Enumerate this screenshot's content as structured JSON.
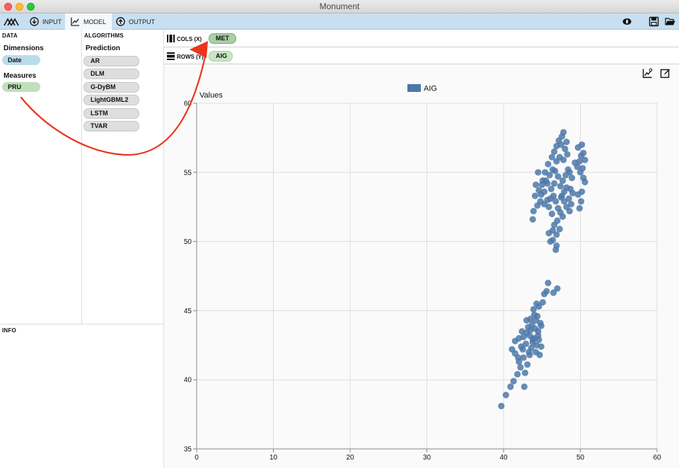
{
  "window": {
    "title": "Monument"
  },
  "tabs": [
    {
      "label": "INPUT",
      "icon": "download-circle-icon"
    },
    {
      "label": "MODEL",
      "icon": "chart-icon"
    },
    {
      "label": "OUTPUT",
      "icon": "upload-circle-icon"
    }
  ],
  "data_panel": {
    "header": "DATA",
    "dimensions_title": "Dimensions",
    "dimensions": [
      "Date"
    ],
    "measures_title": "Measures",
    "measures": [
      "PRU"
    ]
  },
  "algorithms_panel": {
    "header": "ALGORITHMS",
    "section": "Prediction",
    "items": [
      "AR",
      "DLM",
      "G-DyBM",
      "LightGBML2",
      "LSTM",
      "TVAR"
    ]
  },
  "info_panel": {
    "header": "INFO"
  },
  "shelves": {
    "cols_label": "COLS (X)",
    "cols_pill": "MET",
    "rows_label": "ROWS (Y)",
    "rows_pill": "AIG"
  },
  "colors": {
    "accent": "#4c78a8",
    "toolbar": "#c7dff0",
    "annotation": "#e8361d"
  },
  "chart_data": {
    "type": "scatter",
    "legend": [
      "AIG"
    ],
    "legend_position": "top-center",
    "ylabel": "Values",
    "xlim": [
      0,
      60
    ],
    "ylim": [
      35,
      60
    ],
    "xticks": [
      0,
      10,
      20,
      30,
      40,
      50,
      60
    ],
    "yticks": [
      35,
      40,
      45,
      50,
      55,
      60
    ],
    "grid": true,
    "series": [
      {
        "name": "AIG",
        "points": [
          [
            39.7,
            38.1
          ],
          [
            40.3,
            38.9
          ],
          [
            40.9,
            39.5
          ],
          [
            41.3,
            39.9
          ],
          [
            42.7,
            39.5
          ],
          [
            41.8,
            40.4
          ],
          [
            42.2,
            40.9
          ],
          [
            42.0,
            41.3
          ],
          [
            42.6,
            41.6
          ],
          [
            43.1,
            41.1
          ],
          [
            43.4,
            41.8
          ],
          [
            41.1,
            42.2
          ],
          [
            41.5,
            41.9
          ],
          [
            42.3,
            42.4
          ],
          [
            42.9,
            42.6
          ],
          [
            43.6,
            42.3
          ],
          [
            44.2,
            42.0
          ],
          [
            41.5,
            42.8
          ],
          [
            42.0,
            43.0
          ],
          [
            42.6,
            43.1
          ],
          [
            43.0,
            43.4
          ],
          [
            43.4,
            43.2
          ],
          [
            43.8,
            42.9
          ],
          [
            44.3,
            42.5
          ],
          [
            44.6,
            42.9
          ],
          [
            42.4,
            43.5
          ],
          [
            43.2,
            43.8
          ],
          [
            43.7,
            44.0
          ],
          [
            44.1,
            43.7
          ],
          [
            44.5,
            43.5
          ],
          [
            44.9,
            43.9
          ],
          [
            43.5,
            44.4
          ],
          [
            44.0,
            44.7
          ],
          [
            44.4,
            44.6
          ],
          [
            43.9,
            45.1
          ],
          [
            44.6,
            45.3
          ],
          [
            45.1,
            45.6
          ],
          [
            44.3,
            45.5
          ],
          [
            45.3,
            46.2
          ],
          [
            45.6,
            46.4
          ],
          [
            45.8,
            47.0
          ],
          [
            46.5,
            46.3
          ],
          [
            47.0,
            46.6
          ],
          [
            43.8,
            42.7
          ],
          [
            44.0,
            43.0
          ],
          [
            44.5,
            43.2
          ],
          [
            43.3,
            42.0
          ],
          [
            42.5,
            42.2
          ],
          [
            41.9,
            41.6
          ],
          [
            42.8,
            40.5
          ],
          [
            44.7,
            41.8
          ],
          [
            44.9,
            42.4
          ],
          [
            43.0,
            44.3
          ],
          [
            44.8,
            44.1
          ],
          [
            43.5,
            43.6
          ],
          [
            44.2,
            44.3
          ],
          [
            43.8,
            51.6
          ],
          [
            43.9,
            52.2
          ],
          [
            44.4,
            52.6
          ],
          [
            44.8,
            52.9
          ],
          [
            44.1,
            53.3
          ],
          [
            44.6,
            53.7
          ],
          [
            45.0,
            54.1
          ],
          [
            44.2,
            54.1
          ],
          [
            45.3,
            53.6
          ],
          [
            45.7,
            53.0
          ],
          [
            45.9,
            52.5
          ],
          [
            45.5,
            54.4
          ],
          [
            46.0,
            54.8
          ],
          [
            46.4,
            55.2
          ],
          [
            45.8,
            55.6
          ],
          [
            46.3,
            56.1
          ],
          [
            46.6,
            56.5
          ],
          [
            46.9,
            56.9
          ],
          [
            47.2,
            57.3
          ],
          [
            47.6,
            57.6
          ],
          [
            47.8,
            57.9
          ],
          [
            47.3,
            56.1
          ],
          [
            46.9,
            55.8
          ],
          [
            46.7,
            55.1
          ],
          [
            47.1,
            54.7
          ],
          [
            46.6,
            54.2
          ],
          [
            46.2,
            53.8
          ],
          [
            46.5,
            53.3
          ],
          [
            46.8,
            52.9
          ],
          [
            47.1,
            52.4
          ],
          [
            47.4,
            52.1
          ],
          [
            47.7,
            51.8
          ],
          [
            47.0,
            51.5
          ],
          [
            46.6,
            51.2
          ],
          [
            46.4,
            50.8
          ],
          [
            46.9,
            50.5
          ],
          [
            46.4,
            50.1
          ],
          [
            46.9,
            49.7
          ],
          [
            46.8,
            49.4
          ],
          [
            45.9,
            50.6
          ],
          [
            46.1,
            50.0
          ],
          [
            47.3,
            50.9
          ],
          [
            47.5,
            53.2
          ],
          [
            47.9,
            53.6
          ],
          [
            48.2,
            53.9
          ],
          [
            47.7,
            54.4
          ],
          [
            48.1,
            54.8
          ],
          [
            48.4,
            55.2
          ],
          [
            47.8,
            55.9
          ],
          [
            48.3,
            56.3
          ],
          [
            48.0,
            56.7
          ],
          [
            47.5,
            57.0
          ],
          [
            48.2,
            57.2
          ],
          [
            48.6,
            55.0
          ],
          [
            48.9,
            54.6
          ],
          [
            48.5,
            53.1
          ],
          [
            48.8,
            52.7
          ],
          [
            48.2,
            52.5
          ],
          [
            48.6,
            52.2
          ],
          [
            49.0,
            53.5
          ],
          [
            49.3,
            55.7
          ],
          [
            49.6,
            55.4
          ],
          [
            49.9,
            55.8
          ],
          [
            50.1,
            56.2
          ],
          [
            49.7,
            56.8
          ],
          [
            50.2,
            57.0
          ],
          [
            50.4,
            56.4
          ],
          [
            50.6,
            55.9
          ],
          [
            50.3,
            55.3
          ],
          [
            50.0,
            55.0
          ],
          [
            50.4,
            54.6
          ],
          [
            50.6,
            54.3
          ],
          [
            50.2,
            53.6
          ],
          [
            49.7,
            53.4
          ],
          [
            50.1,
            52.9
          ],
          [
            49.9,
            52.4
          ],
          [
            45.1,
            54.4
          ],
          [
            45.4,
            55.0
          ],
          [
            45.7,
            54.2
          ],
          [
            46.1,
            53.1
          ],
          [
            44.5,
            55.0
          ],
          [
            44.9,
            53.4
          ],
          [
            45.3,
            52.7
          ],
          [
            48.7,
            53.8
          ],
          [
            47.9,
            52.9
          ],
          [
            47.6,
            53.3
          ],
          [
            46.3,
            52.0
          ],
          [
            47.4,
            54.0
          ]
        ]
      }
    ]
  }
}
